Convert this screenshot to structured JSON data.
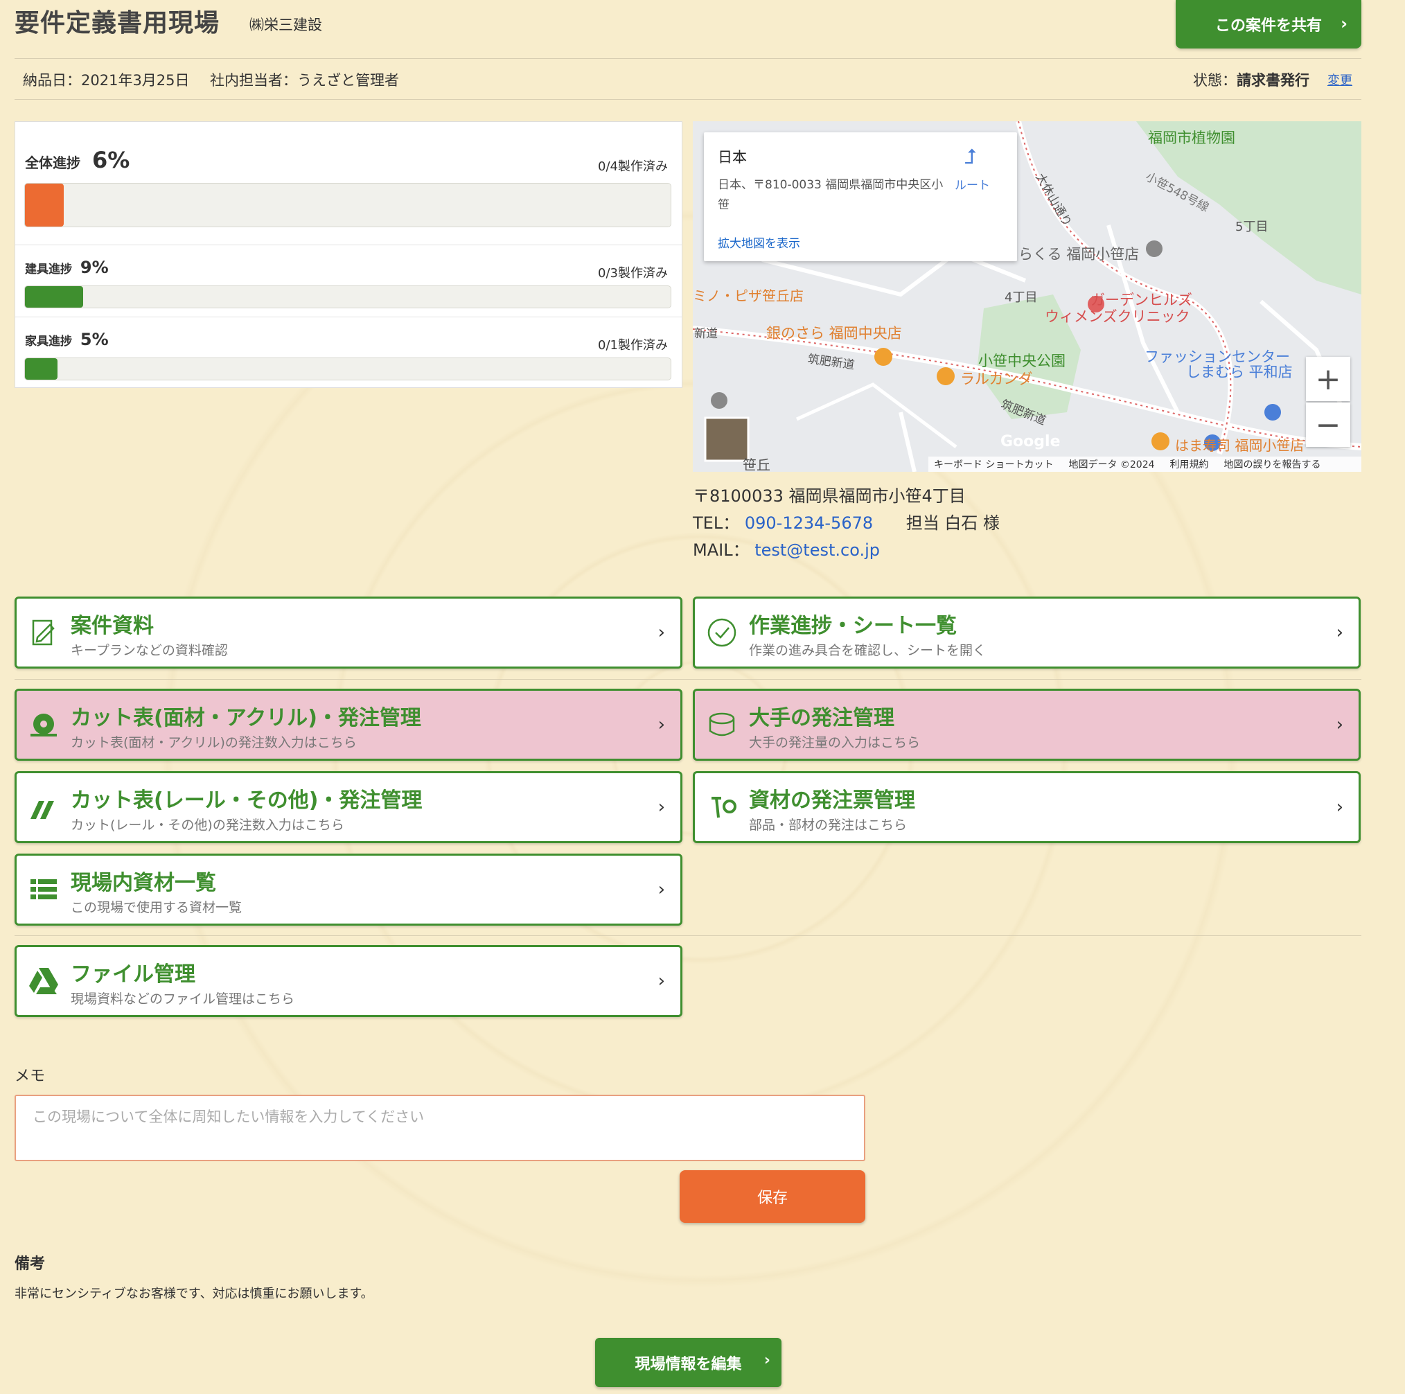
{
  "header": {
    "title": "要件定義書用現場",
    "company": "㈱栄三建設",
    "share_label": "この案件を共有",
    "delivery": "納品日：2021年3月25日",
    "manager": "社内担当者：うえざと管理者",
    "status_label": "状態：",
    "status_value": "請求書発行",
    "status_change": "変更"
  },
  "progress": [
    {
      "label": "全体進捗",
      "percent_text": "6%",
      "value": 0.06,
      "count": "0/4製作済み",
      "color": "#ec6b32"
    },
    {
      "label": "建具進捗",
      "percent_text": "9%",
      "value": 0.09,
      "count": "0/3製作済み",
      "color": "#3f8f2f"
    },
    {
      "label": "家具進捗",
      "percent_text": "5%",
      "value": 0.05,
      "count": "0/1製作済み",
      "color": "#3f8f2f"
    }
  ],
  "map": {
    "info_title": "日本",
    "info_address": "日本、〒810-0033 福岡県福岡市中央区小笹",
    "info_route": "ルート",
    "info_enlarge": "拡大地図を表示",
    "labels": [
      "福岡市植物園",
      "小笹548号線",
      "大休山通り",
      "5丁目",
      "らくる 福岡小笹店",
      "4丁目",
      "ガーデンヒルズ",
      "ウィメンズクリニック",
      "ミノ・ピザ笹丘店",
      "銀のさら 福岡中央店",
      "筑肥新道",
      "小笹中央公園",
      "ラルカンダ",
      "ファッションセンター",
      "しまむら 平和店",
      "筑肥新道",
      "はま寿司 福岡小笹店",
      "笹丘",
      "新道"
    ],
    "footer": [
      "キーボード ショートカット",
      "地図データ ©2024",
      "利用規約",
      "地図の誤りを報告する"
    ],
    "zoom_in": "+",
    "zoom_out": "−"
  },
  "contact": {
    "address": "〒8100033 福岡県福岡市小笹4丁目",
    "tel_label": "TEL：",
    "tel": "090-1234-5678",
    "person": "担当 白石 様",
    "mail_label": "MAIL：",
    "mail": "test@test.co.jp"
  },
  "menu": [
    {
      "title": "案件資料",
      "sub": "キープランなどの資料確認",
      "icon": "document-edit-icon"
    },
    {
      "title": "作業進捗・シート一覧",
      "sub": "作業の進み具合を確認し、シートを開く",
      "icon": "check-circle-icon"
    },
    {
      "title": "カット表(面材・アクリル)・発注管理",
      "sub": "カット表(面材・アクリル)の発注数入力はこちら",
      "icon": "saw-blade-icon"
    },
    {
      "title": "大手の発注管理",
      "sub": "大手の発注量の入力はこちら",
      "icon": "tape-roll-icon"
    },
    {
      "title": "カット表(レール・その他)・発注管理",
      "sub": "カット(レール・その他)の発注数入力はこちら",
      "icon": "rails-icon"
    },
    {
      "title": "資材の発注票管理",
      "sub": "部品・部材の発注はこちら",
      "icon": "screw-nut-icon"
    },
    {
      "title": "現場内資材一覧",
      "sub": "この現場で使用する資材一覧",
      "icon": "list-icon"
    },
    {
      "title": "ファイル管理",
      "sub": "現場資料などのファイル管理はこちら",
      "icon": "drive-icon"
    }
  ],
  "memo": {
    "label": "メモ",
    "placeholder": "この現場について全体に周知したい情報を入力してください",
    "save": "保存"
  },
  "note": {
    "label": "備考",
    "text": "非常にセンシティブなお客様です、対応は慎重にお願いします。"
  },
  "edit_label": "現場情報を編集",
  "colors": {
    "green": "#3f8f2f",
    "orange": "#ec6b32",
    "pink": "#eec5d0"
  }
}
